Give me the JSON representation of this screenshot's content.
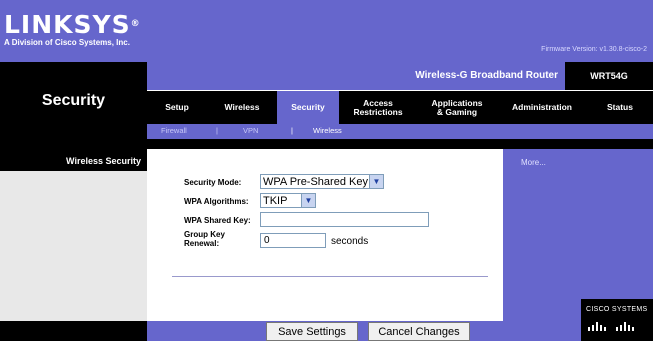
{
  "brand": {
    "logo": "LINKSYS",
    "registered": "®",
    "subtitle": "A Division of Cisco Systems, Inc.",
    "firmware": "Firmware Version: v1.30.8-cisco-2"
  },
  "product": {
    "name": "Wireless-G Broadband Router",
    "model": "WRT54G"
  },
  "section_title": "Security",
  "nav": {
    "tabs": [
      {
        "label": "Setup",
        "active": false
      },
      {
        "label": "Wireless",
        "active": false
      },
      {
        "label": "Security",
        "active": true
      },
      {
        "label": "Access\nRestrictions",
        "active": false
      },
      {
        "label": "Applications\n& Gaming",
        "active": false
      },
      {
        "label": "Administration",
        "active": false
      },
      {
        "label": "Status",
        "active": false
      }
    ],
    "subtabs": [
      {
        "label": "Firewall",
        "active": false
      },
      {
        "label": "|",
        "active": false
      },
      {
        "label": "VPN",
        "active": false
      },
      {
        "label": "|",
        "active": true
      },
      {
        "label": "Wireless",
        "active": true
      }
    ]
  },
  "sidebar": {
    "label": "Wireless Security"
  },
  "form": {
    "security_mode": {
      "label": "Security Mode:",
      "value": "WPA Pre-Shared Key"
    },
    "wpa_algorithms": {
      "label": "WPA Algorithms:",
      "value": "TKIP"
    },
    "wpa_shared_key": {
      "label": "WPA Shared  Key:",
      "value": ""
    },
    "group_key_renewal": {
      "label": "Group Key\nRenewal:",
      "value": "0",
      "suffix": "seconds"
    }
  },
  "help": {
    "more": "More..."
  },
  "actions": {
    "save": "Save Settings",
    "cancel": "Cancel Changes"
  },
  "cisco": {
    "text": "CISCO SYSTEMS"
  },
  "colors": {
    "accent": "#6666cc",
    "dark": "#000000"
  }
}
